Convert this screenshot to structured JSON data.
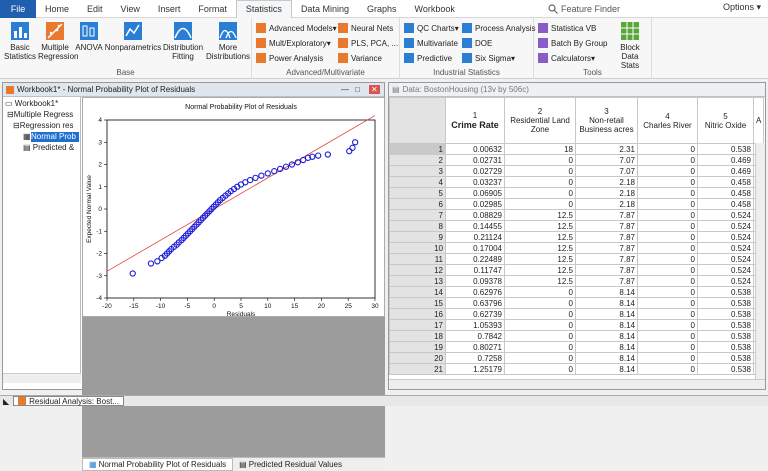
{
  "menubar": {
    "file": "File",
    "tabs": [
      "Home",
      "Edit",
      "View",
      "Insert",
      "Format",
      "Statistics",
      "Data Mining",
      "Graphs",
      "Workbook"
    ],
    "active_tab": "Statistics",
    "feature_finder": "Feature Finder",
    "options": "Options"
  },
  "ribbon": {
    "base": {
      "label": "Base",
      "buttons": [
        "Basic Statistics",
        "Multiple Regression",
        "ANOVA",
        "Nonparametrics",
        "Distribution Fitting",
        "More Distributions"
      ]
    },
    "advanced": {
      "label": "Advanced/Multivariate",
      "items": [
        "Advanced Models",
        "Mult/Exploratory",
        "Power Analysis",
        "Neural Nets",
        "PLS, PCA, ...",
        "Variance"
      ]
    },
    "industrial": {
      "label": "Industrial Statistics",
      "items": [
        "QC Charts",
        "Multivariate",
        "Predictive",
        "Process Analysis",
        "DOE",
        "Six Sigma"
      ]
    },
    "tools": {
      "label": "Tools",
      "items": [
        "Statistica VB",
        "Batch By Group",
        "Calculators",
        "Block Data Stats"
      ]
    }
  },
  "workbook": {
    "title": "Workbook1* - Normal Probability Plot of Residuals",
    "tree": [
      {
        "label": "Workbook1*"
      },
      {
        "label": "Multiple Regress"
      },
      {
        "label": "Regression res"
      },
      {
        "label": "Normal Prob"
      },
      {
        "label": "Predicted &"
      }
    ],
    "tabs": [
      "Normal Probability Plot of Residuals",
      "Predicted  Residual Values"
    ]
  },
  "chart_data": {
    "type": "scatter",
    "title": "Normal Probability Plot of Residuals",
    "xlabel": "Residuals",
    "ylabel": "Expected Normal Value",
    "xlim": [
      -20,
      30
    ],
    "ylim": [
      -4,
      4
    ],
    "xticks": [
      -20,
      -15,
      -10,
      -5,
      0,
      5,
      10,
      15,
      20,
      25,
      30
    ],
    "yticks": [
      -4,
      -3,
      -2,
      -1,
      0,
      1,
      2,
      3,
      4
    ],
    "reference_line": [
      [
        -20,
        -2.8
      ],
      [
        30,
        4.2
      ]
    ],
    "points": [
      [
        -15.2,
        -2.9
      ],
      [
        -11.8,
        -2.45
      ],
      [
        -10.6,
        -2.35
      ],
      [
        -9.8,
        -2.2
      ],
      [
        -9.2,
        -2.1
      ],
      [
        -8.8,
        -2.0
      ],
      [
        -8.4,
        -1.9
      ],
      [
        -8.0,
        -1.8
      ],
      [
        -7.5,
        -1.7
      ],
      [
        -7.0,
        -1.6
      ],
      [
        -6.6,
        -1.5
      ],
      [
        -6.1,
        -1.4
      ],
      [
        -5.7,
        -1.3
      ],
      [
        -5.3,
        -1.2
      ],
      [
        -4.9,
        -1.1
      ],
      [
        -4.5,
        -1.0
      ],
      [
        -4.1,
        -0.9
      ],
      [
        -3.7,
        -0.8
      ],
      [
        -3.3,
        -0.7
      ],
      [
        -2.9,
        -0.6
      ],
      [
        -2.5,
        -0.5
      ],
      [
        -2.1,
        -0.4
      ],
      [
        -1.7,
        -0.3
      ],
      [
        -1.3,
        -0.2
      ],
      [
        -0.9,
        -0.1
      ],
      [
        -0.5,
        0.0
      ],
      [
        -0.1,
        0.1
      ],
      [
        0.3,
        0.2
      ],
      [
        0.7,
        0.3
      ],
      [
        1.1,
        0.4
      ],
      [
        1.6,
        0.5
      ],
      [
        2.1,
        0.6
      ],
      [
        2.6,
        0.7
      ],
      [
        3.1,
        0.8
      ],
      [
        3.7,
        0.9
      ],
      [
        4.3,
        1.0
      ],
      [
        5.0,
        1.1
      ],
      [
        5.8,
        1.2
      ],
      [
        6.7,
        1.3
      ],
      [
        7.7,
        1.4
      ],
      [
        8.8,
        1.5
      ],
      [
        10.0,
        1.6
      ],
      [
        11.2,
        1.7
      ],
      [
        12.3,
        1.8
      ],
      [
        13.4,
        1.9
      ],
      [
        14.5,
        2.0
      ],
      [
        15.6,
        2.1
      ],
      [
        16.6,
        2.2
      ],
      [
        17.5,
        2.3
      ],
      [
        18.3,
        2.35
      ],
      [
        19.4,
        2.4
      ],
      [
        21.2,
        2.45
      ],
      [
        25.2,
        2.6
      ],
      [
        25.8,
        2.75
      ],
      [
        26.3,
        3.0
      ]
    ]
  },
  "data": {
    "title": "Data: BostonHousing (13v by 506c)",
    "columns": [
      {
        "num": "1",
        "name": "Crime Rate"
      },
      {
        "num": "2",
        "name": "Residential Land Zone"
      },
      {
        "num": "3",
        "name": "Non-retail Business acres"
      },
      {
        "num": "4",
        "name": "Charles River"
      },
      {
        "num": "5",
        "name": "Nitric Oxide"
      },
      {
        "num": "",
        "name": "A"
      }
    ],
    "rows": [
      [
        "1",
        "0.00632",
        "18",
        "2.31",
        "0",
        "0.538"
      ],
      [
        "2",
        "0.02731",
        "0",
        "7.07",
        "0",
        "0.469"
      ],
      [
        "3",
        "0.02729",
        "0",
        "7.07",
        "0",
        "0.469"
      ],
      [
        "4",
        "0.03237",
        "0",
        "2.18",
        "0",
        "0.458"
      ],
      [
        "5",
        "0.06905",
        "0",
        "2.18",
        "0",
        "0.458"
      ],
      [
        "6",
        "0.02985",
        "0",
        "2.18",
        "0",
        "0.458"
      ],
      [
        "7",
        "0.08829",
        "12.5",
        "7.87",
        "0",
        "0.524"
      ],
      [
        "8",
        "0.14455",
        "12.5",
        "7.87",
        "0",
        "0.524"
      ],
      [
        "9",
        "0.21124",
        "12.5",
        "7.87",
        "0",
        "0.524"
      ],
      [
        "10",
        "0.17004",
        "12.5",
        "7.87",
        "0",
        "0.524"
      ],
      [
        "11",
        "0.22489",
        "12.5",
        "7.87",
        "0",
        "0.524"
      ],
      [
        "12",
        "0.11747",
        "12.5",
        "7.87",
        "0",
        "0.524"
      ],
      [
        "13",
        "0.09378",
        "12.5",
        "7.87",
        "0",
        "0.524"
      ],
      [
        "14",
        "0.62976",
        "0",
        "8.14",
        "0",
        "0.538"
      ],
      [
        "15",
        "0.63796",
        "0",
        "8.14",
        "0",
        "0.538"
      ],
      [
        "16",
        "0.62739",
        "0",
        "8.14",
        "0",
        "0.538"
      ],
      [
        "17",
        "1.05393",
        "0",
        "8.14",
        "0",
        "0.538"
      ],
      [
        "18",
        "0.7842",
        "0",
        "8.14",
        "0",
        "0.538"
      ],
      [
        "19",
        "0.80271",
        "0",
        "8.14",
        "0",
        "0.538"
      ],
      [
        "20",
        "0.7258",
        "0",
        "8.14",
        "0",
        "0.538"
      ],
      [
        "21",
        "1.25179",
        "0",
        "8.14",
        "0",
        "0.538"
      ]
    ]
  },
  "taskbar": {
    "item": "Residual Analysis: Bost..."
  },
  "colors": {
    "accent": "#1f5fae",
    "points": "#1a1ad6",
    "refline": "#e0463c"
  }
}
